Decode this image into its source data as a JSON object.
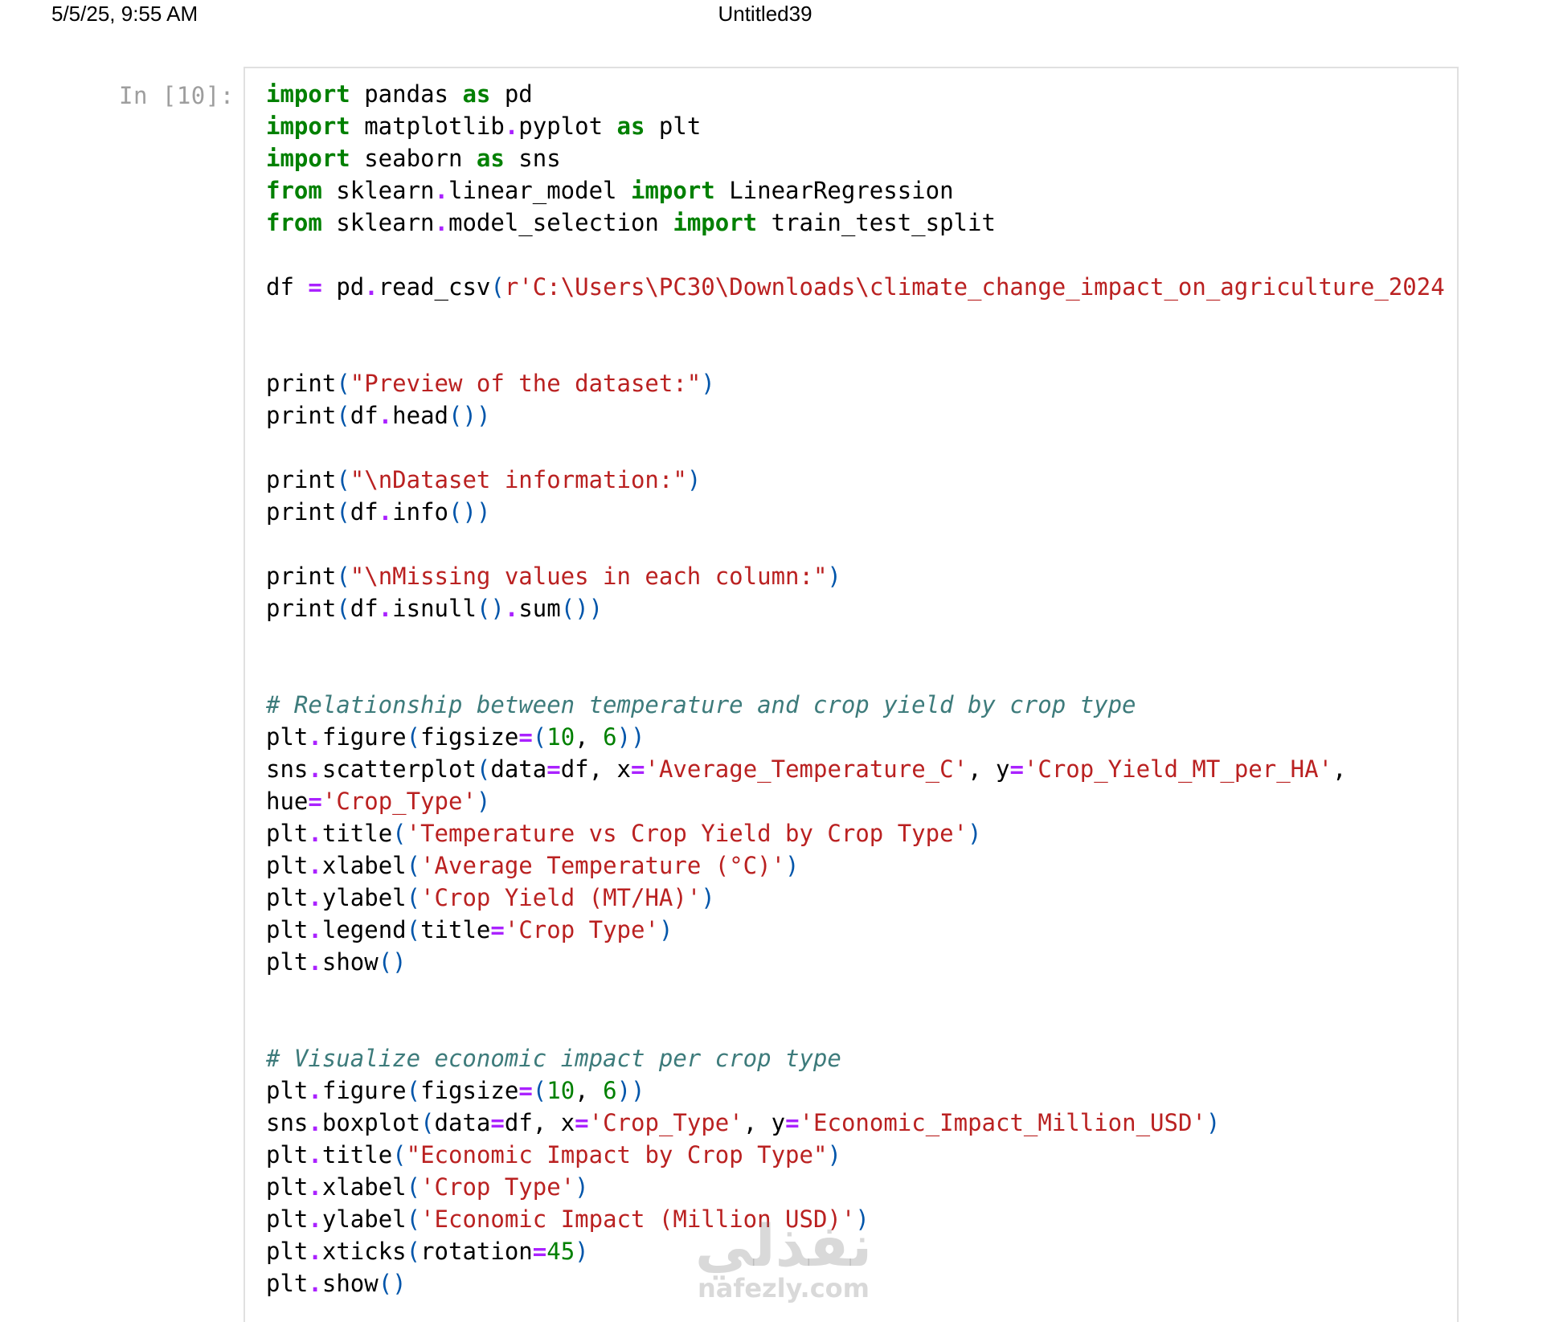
{
  "header": {
    "timestamp": "5/5/25, 9:55 AM",
    "notebook_title": "Untitled39"
  },
  "cell": {
    "prompt": "In [10]:",
    "code_lines": [
      "import pandas as pd",
      "import matplotlib.pyplot as plt",
      "import seaborn as sns",
      "from sklearn.linear_model import LinearRegression",
      "from sklearn.model_selection import train_test_split",
      "",
      "df = pd.read_csv(r'C:\\Users\\PC30\\Downloads\\climate_change_impact_on_agriculture_2024",
      "",
      "",
      "print(\"Preview of the dataset:\")",
      "print(df.head())",
      "",
      "print(\"\\nDataset information:\")",
      "print(df.info())",
      "",
      "print(\"\\nMissing values in each column:\")",
      "print(df.isnull().sum())",
      "",
      "",
      "# Relationship between temperature and crop yield by crop type",
      "plt.figure(figsize=(10, 6))",
      "sns.scatterplot(data=df, x='Average_Temperature_C', y='Crop_Yield_MT_per_HA',",
      "hue='Crop_Type')",
      "plt.title('Temperature vs Crop Yield by Crop Type')",
      "plt.xlabel('Average Temperature (°C)')",
      "plt.ylabel('Crop Yield (MT/HA)')",
      "plt.legend(title='Crop Type')",
      "plt.show()",
      "",
      "",
      "# Visualize economic impact per crop type",
      "plt.figure(figsize=(10, 6))",
      "sns.boxplot(data=df, x='Crop_Type', y='Economic_Impact_Million_USD')",
      "plt.title(\"Economic Impact by Crop Type\")",
      "plt.xlabel('Crop Type')",
      "plt.ylabel('Economic Impact (Million USD)')",
      "plt.xticks(rotation=45)",
      "plt.show()"
    ]
  },
  "watermark": {
    "arabic_text": "نفذلي",
    "latin_text": "nafezly.com"
  }
}
